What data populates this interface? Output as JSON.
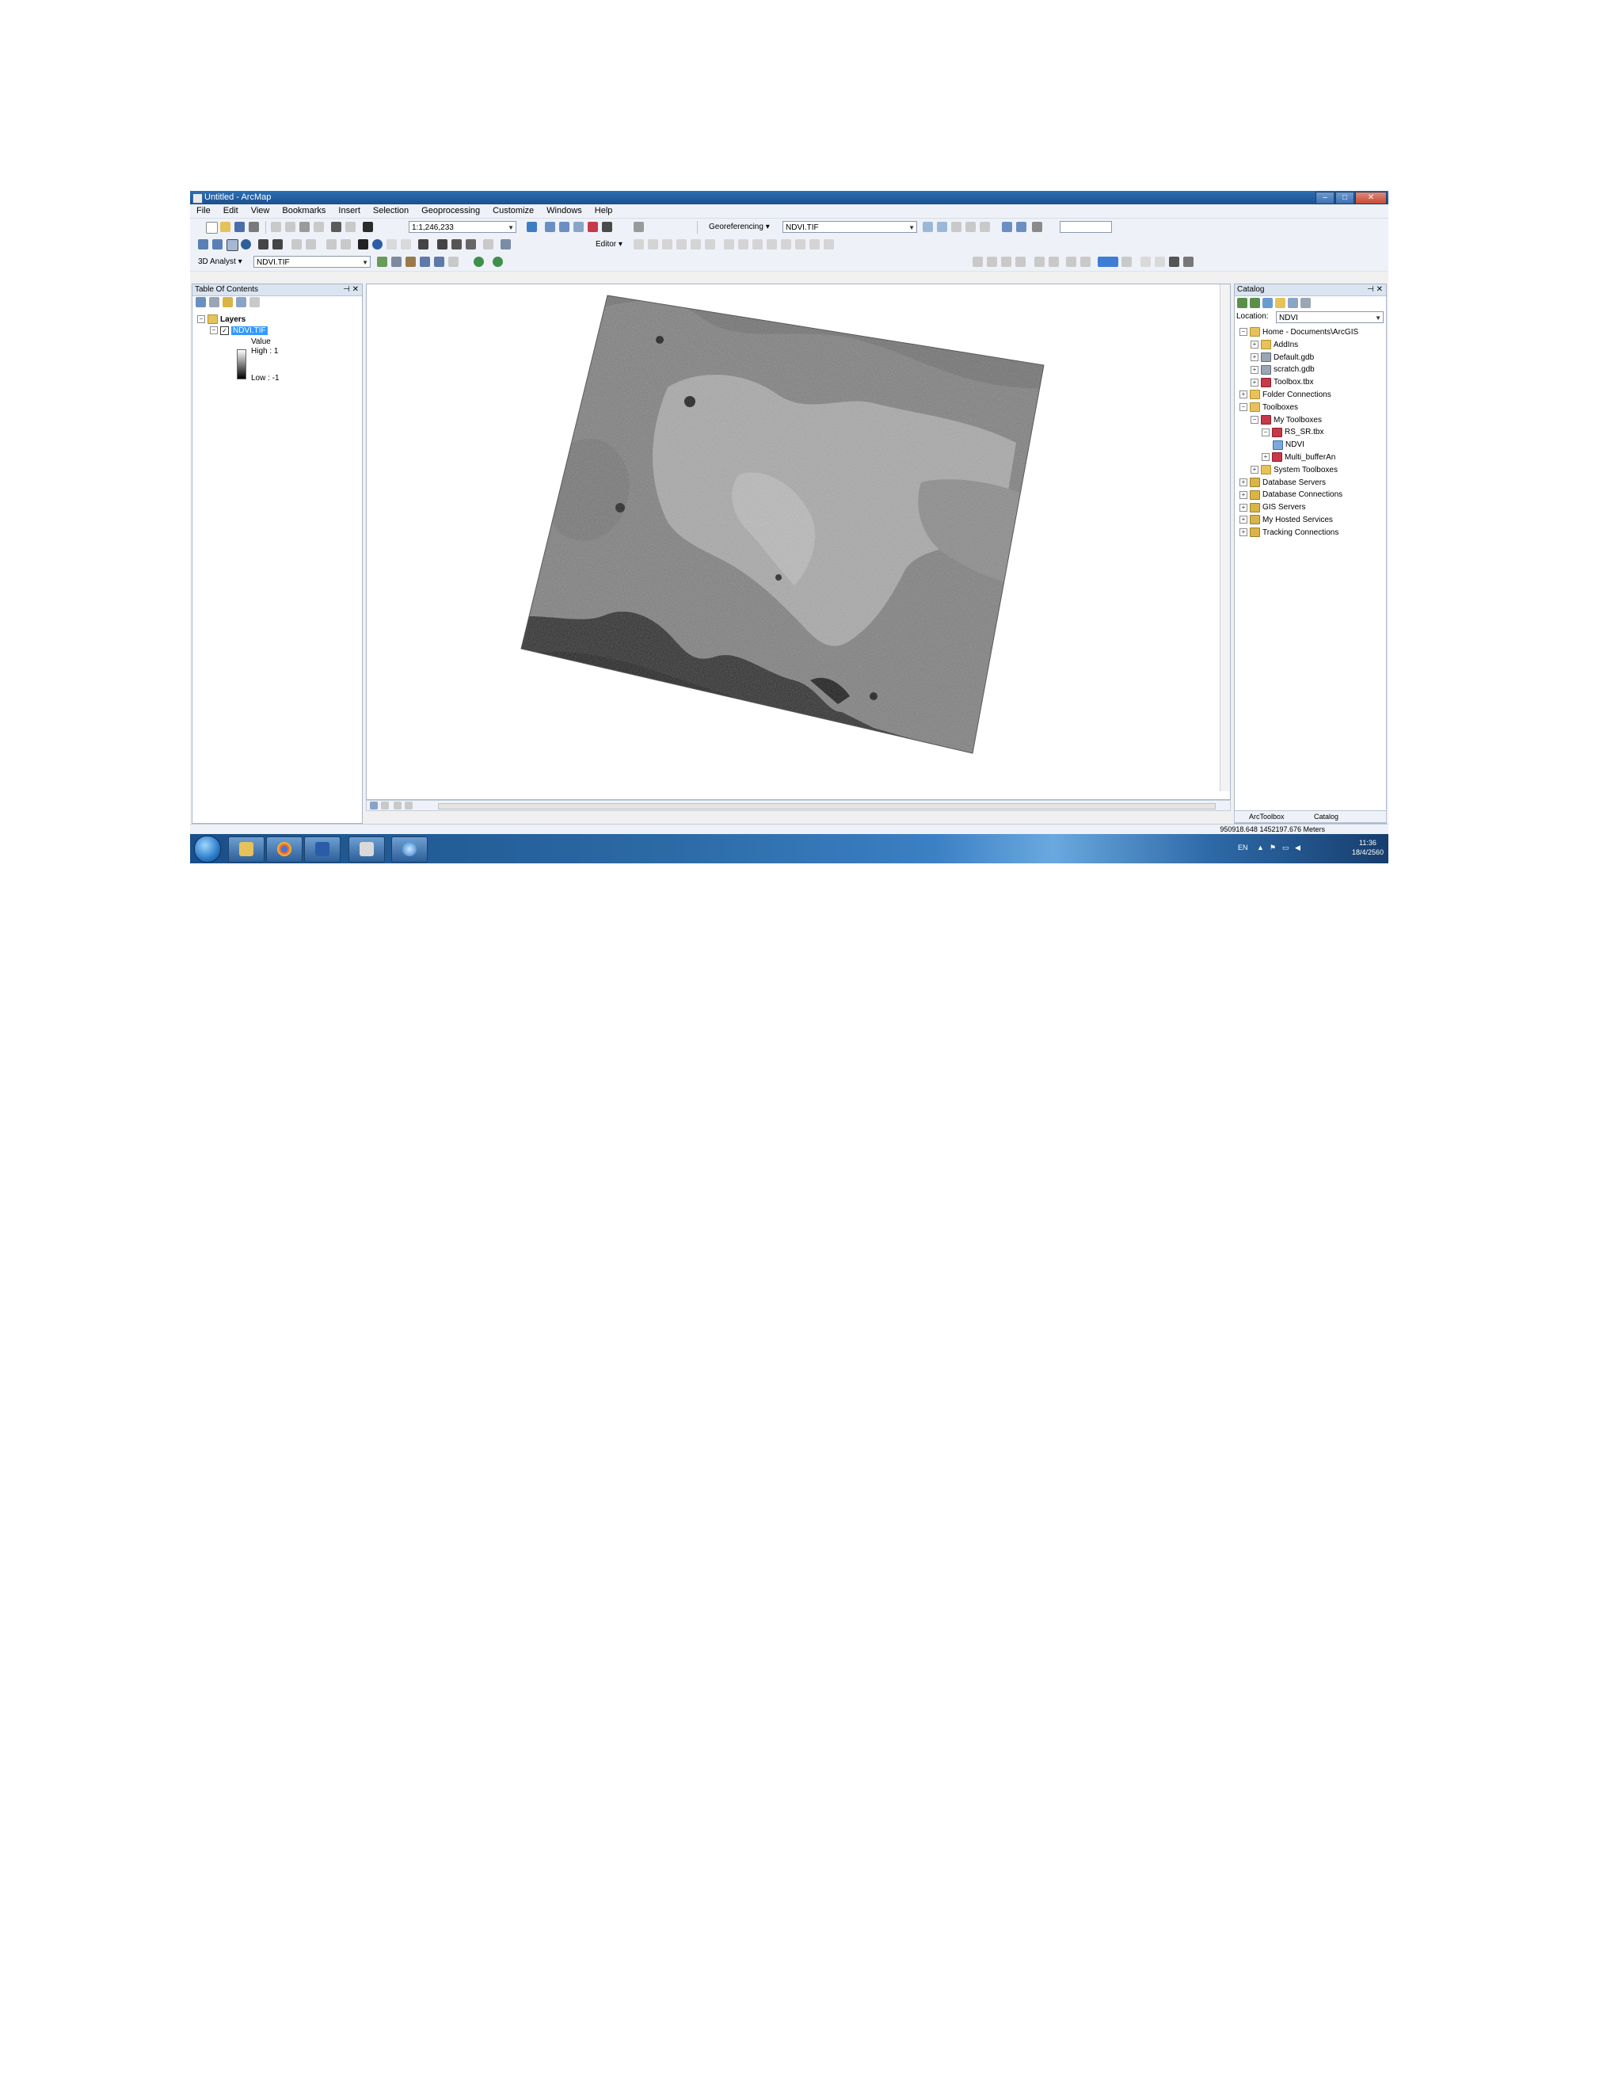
{
  "window": {
    "title": "Untitled - ArcMap",
    "controls": [
      "–",
      "□",
      "✕"
    ]
  },
  "menu": [
    "File",
    "Edit",
    "View",
    "Bookmarks",
    "Insert",
    "Selection",
    "Geoprocessing",
    "Customize",
    "Windows",
    "Help"
  ],
  "toolbar": {
    "scale_value": "1:1,246,233",
    "georeferencing_label": "Georeferencing ▾",
    "georef_layer": "NDVI.TIF",
    "editor_label": "Editor ▾",
    "analyst_label": "3D Analyst ▾",
    "analyst_layer": "NDVI.TIF"
  },
  "toc": {
    "header": "Table Of Contents",
    "layers_label": "Layers",
    "layer_name": "NDVI.TIF",
    "legend_value_label": "Value",
    "legend_high": "High : 1",
    "legend_low": "Low : -1"
  },
  "catalog": {
    "header": "Catalog",
    "location_label": "Location:",
    "location_value": "NDVI",
    "items": [
      {
        "label": "Home - Documents\\ArcGIS",
        "indent": 0,
        "exp": "⊟",
        "icon": "folder"
      },
      {
        "label": "AddIns",
        "indent": 1,
        "exp": "⊞",
        "icon": "folder"
      },
      {
        "label": "Default.gdb",
        "indent": 1,
        "exp": "⊞",
        "icon": "gdb"
      },
      {
        "label": "scratch.gdb",
        "indent": 1,
        "exp": "⊞",
        "icon": "gdb"
      },
      {
        "label": "Toolbox.tbx",
        "indent": 1,
        "exp": "⊞",
        "icon": "toolbox"
      },
      {
        "label": "Folder Connections",
        "indent": 0,
        "exp": "⊞",
        "icon": "folder"
      },
      {
        "label": "Toolboxes",
        "indent": 0,
        "exp": "⊟",
        "icon": "folder"
      },
      {
        "label": "My Toolboxes",
        "indent": 1,
        "exp": "⊟",
        "icon": "toolbox"
      },
      {
        "label": "RS_SR.tbx",
        "indent": 2,
        "exp": "⊟",
        "icon": "toolbox"
      },
      {
        "label": "NDVI",
        "indent": 3,
        "exp": "",
        "icon": "script"
      },
      {
        "label": "Multi_bufferAn",
        "indent": 2,
        "exp": "⊞",
        "icon": "toolbox"
      },
      {
        "label": "System Toolboxes",
        "indent": 1,
        "exp": "⊞",
        "icon": "folder"
      },
      {
        "label": "Database Servers",
        "indent": 0,
        "exp": "⊞",
        "icon": "servers"
      },
      {
        "label": "Database Connections",
        "indent": 0,
        "exp": "⊞",
        "icon": "servers"
      },
      {
        "label": "GIS Servers",
        "indent": 0,
        "exp": "⊞",
        "icon": "servers"
      },
      {
        "label": "My Hosted Services",
        "indent": 0,
        "exp": "⊞",
        "icon": "servers"
      },
      {
        "label": "Tracking Connections",
        "indent": 0,
        "exp": "⊞",
        "icon": "servers"
      }
    ],
    "tab_toolbox": "ArcToolbox",
    "tab_catalog": "Catalog"
  },
  "status": {
    "coordinates": "950918.648  1452197.676 Meters"
  },
  "taskbar": {
    "tray_lang": "EN",
    "clock_time": "11:36",
    "clock_date": "18/4/2560"
  },
  "colors": {
    "titlebar": "#1c4f8e",
    "selection": "#3399ff",
    "taskbar": "#2c6aa6"
  }
}
